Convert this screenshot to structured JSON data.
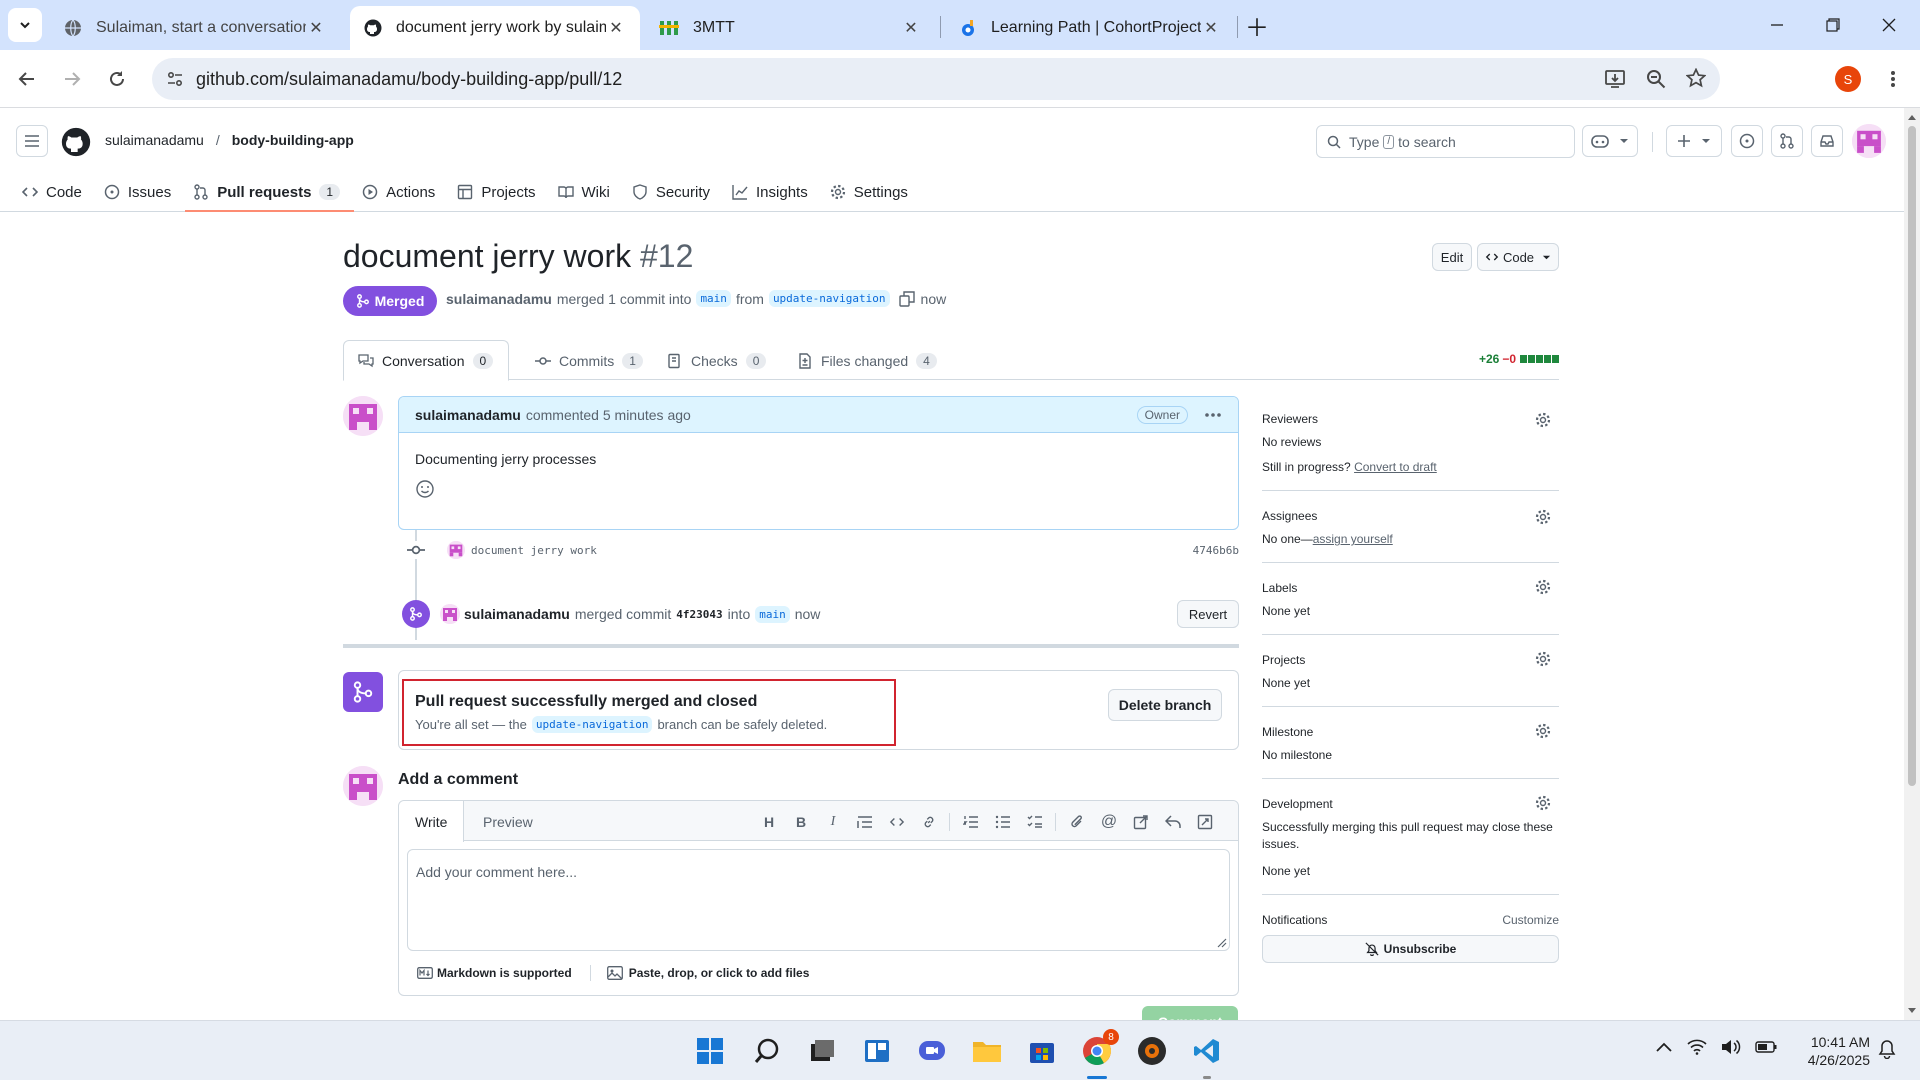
{
  "browser": {
    "tabs": [
      {
        "title": "Sulaiman, start a conversation w",
        "icon": "globe-icon"
      },
      {
        "title": "document jerry work by sulaima",
        "icon": "github-icon",
        "active": true
      },
      {
        "title": "3MTT",
        "icon": "3mtt-icon"
      },
      {
        "title": "Learning Path | CohortProject | L",
        "icon": "learning-path-icon"
      }
    ],
    "url": "github.com/sulaimanadamu/body-building-app/pull/12",
    "profile_initial": "S"
  },
  "github": {
    "owner": "sulaimanadamu",
    "separator": "/",
    "repo": "body-building-app",
    "search_placeholder_pre": "Type",
    "search_key": "/",
    "search_placeholder_post": "to search",
    "nav": {
      "code": "Code",
      "issues": "Issues",
      "pulls": "Pull requests",
      "pulls_count": "1",
      "actions": "Actions",
      "projects": "Projects",
      "wiki": "Wiki",
      "security": "Security",
      "insights": "Insights",
      "settings": "Settings"
    }
  },
  "pr": {
    "title": "document jerry work",
    "number": "#12",
    "edit_label": "Edit",
    "code_label": "Code",
    "state": "Merged",
    "author": "sulaimanadamu",
    "merge_text": "merged 1 commit into",
    "base_branch": "main",
    "from_text": "from",
    "head_branch": "update-navigation",
    "when": "now",
    "tabs": {
      "conversation": "Conversation",
      "conversation_count": "0",
      "commits": "Commits",
      "commits_count": "1",
      "checks": "Checks",
      "checks_count": "0",
      "files": "Files changed",
      "files_count": "4"
    },
    "additions": "+26",
    "deletions": "−0"
  },
  "comment": {
    "author": "sulaimanadamu",
    "meta": "commented 5 minutes ago",
    "role": "Owner",
    "body": "Documenting jerry processes"
  },
  "commit": {
    "message": "document jerry work",
    "sha": "4746b6b"
  },
  "merge_event": {
    "actor": "sulaimanadamu",
    "text": "merged commit",
    "sha": "4f23043",
    "into": "into",
    "branch": "main",
    "when": "now",
    "revert_label": "Revert"
  },
  "merged_box": {
    "title": "Pull request successfully merged and closed",
    "pre": "You're all set — the",
    "branch": "update-navigation",
    "post": "branch can be safely deleted.",
    "delete_label": "Delete branch"
  },
  "add_comment": {
    "heading": "Add a comment",
    "write_tab": "Write",
    "preview_tab": "Preview",
    "placeholder": "Add your comment here...",
    "markdown_note": "Markdown is supported",
    "attach_note": "Paste, drop, or click to add files",
    "submit_label": "Comment"
  },
  "sidebar": {
    "reviewers_h": "Reviewers",
    "reviewers_v": "No reviews",
    "progress_text": "Still in progress?",
    "convert_link": "Convert to draft",
    "assignees_h": "Assignees",
    "assignees_v": "No one—",
    "assign_link": "assign yourself",
    "labels_h": "Labels",
    "labels_v": "None yet",
    "projects_h": "Projects",
    "projects_v": "None yet",
    "milestone_h": "Milestone",
    "milestone_v": "No milestone",
    "development_h": "Development",
    "development_desc": "Successfully merging this pull request may close these issues.",
    "development_v": "None yet",
    "notifications_h": "Notifications",
    "customize_link": "Customize",
    "unsubscribe_label": "Unsubscribe"
  },
  "taskbar": {
    "time": "10:41 AM",
    "date": "4/26/2025",
    "chrome_badge": "8"
  },
  "colors": {
    "merged_purple": "#8250df",
    "link_blue": "#0969da",
    "add_green": "#1a7f37",
    "del_red": "#d1242f",
    "highlight_red": "#d1242f"
  }
}
